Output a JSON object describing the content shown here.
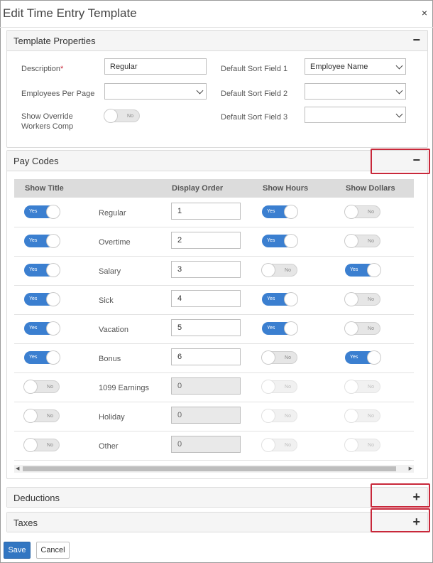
{
  "modal": {
    "title": "Edit Time Entry Template",
    "close_label": "×"
  },
  "template_properties": {
    "title": "Template Properties",
    "toggle_label": "−",
    "description": {
      "label": "Description",
      "required_mark": "*",
      "value": "Regular"
    },
    "employees_per_page": {
      "label": "Employees Per Page",
      "value": ""
    },
    "show_override": {
      "label_line1": "Show Override",
      "label_line2": "Workers Comp",
      "state_label": "No",
      "on": false
    },
    "sort1": {
      "label": "Default Sort Field 1",
      "value": "Employee Name"
    },
    "sort2": {
      "label": "Default Sort Field 2",
      "value": ""
    },
    "sort3": {
      "label": "Default Sort Field 3",
      "value": ""
    }
  },
  "pay_codes": {
    "title": "Pay Codes",
    "toggle_label": "−",
    "columns": [
      "Show Title",
      "Display Order",
      "Show Hours",
      "Show Dollars"
    ],
    "yes_label": "Yes",
    "no_label": "No",
    "rows": [
      {
        "name": "Regular",
        "show_title": true,
        "order": "1",
        "show_hours": true,
        "show_dollars": false,
        "enabled": true
      },
      {
        "name": "Overtime",
        "show_title": true,
        "order": "2",
        "show_hours": true,
        "show_dollars": false,
        "enabled": true
      },
      {
        "name": "Salary",
        "show_title": true,
        "order": "3",
        "show_hours": false,
        "show_dollars": true,
        "enabled": true
      },
      {
        "name": "Sick",
        "show_title": true,
        "order": "4",
        "show_hours": true,
        "show_dollars": false,
        "enabled": true
      },
      {
        "name": "Vacation",
        "show_title": true,
        "order": "5",
        "show_hours": true,
        "show_dollars": false,
        "enabled": true
      },
      {
        "name": "Bonus",
        "show_title": true,
        "order": "6",
        "show_hours": false,
        "show_dollars": true,
        "enabled": true
      },
      {
        "name": "1099 Earnings",
        "show_title": false,
        "order": "0",
        "show_hours": false,
        "show_dollars": false,
        "enabled": false
      },
      {
        "name": "Holiday",
        "show_title": false,
        "order": "0",
        "show_hours": false,
        "show_dollars": false,
        "enabled": false
      },
      {
        "name": "Other",
        "show_title": false,
        "order": "0",
        "show_hours": false,
        "show_dollars": false,
        "enabled": false
      }
    ]
  },
  "deductions": {
    "title": "Deductions",
    "toggle_label": "+"
  },
  "taxes": {
    "title": "Taxes",
    "toggle_label": "+"
  },
  "footer": {
    "save_label": "Save",
    "cancel_label": "Cancel"
  },
  "colors": {
    "accent": "#3b7fd0",
    "highlight": "#c8283a",
    "header_bg": "#f5f5f5"
  }
}
